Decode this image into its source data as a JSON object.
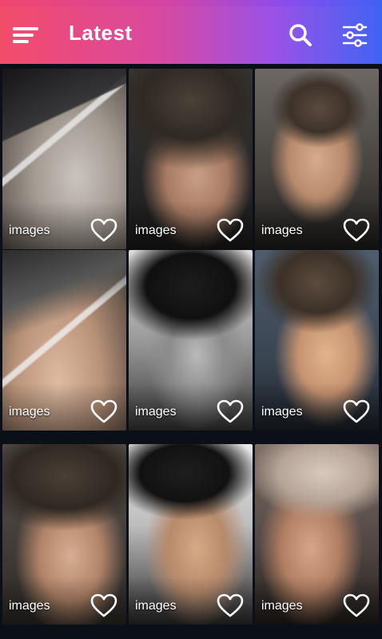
{
  "app": {
    "title": "Latest"
  },
  "icons": {
    "menu": "hamburger-menu-icon",
    "search": "search-icon",
    "filter": "sliders-filter-icon",
    "favorite": "heart-outline-icon"
  },
  "colors": {
    "gradient_start": "#f34c6a",
    "gradient_mid": "#d849a0",
    "gradient_end": "#3f63f3",
    "background": "#0b0f18",
    "label": "#ffffff"
  },
  "grid": {
    "items": [
      {
        "label": "images"
      },
      {
        "label": "images"
      },
      {
        "label": "images"
      },
      {
        "label": "images"
      },
      {
        "label": "images"
      },
      {
        "label": "images"
      },
      {
        "label": "images"
      },
      {
        "label": "images"
      },
      {
        "label": "images"
      }
    ]
  }
}
